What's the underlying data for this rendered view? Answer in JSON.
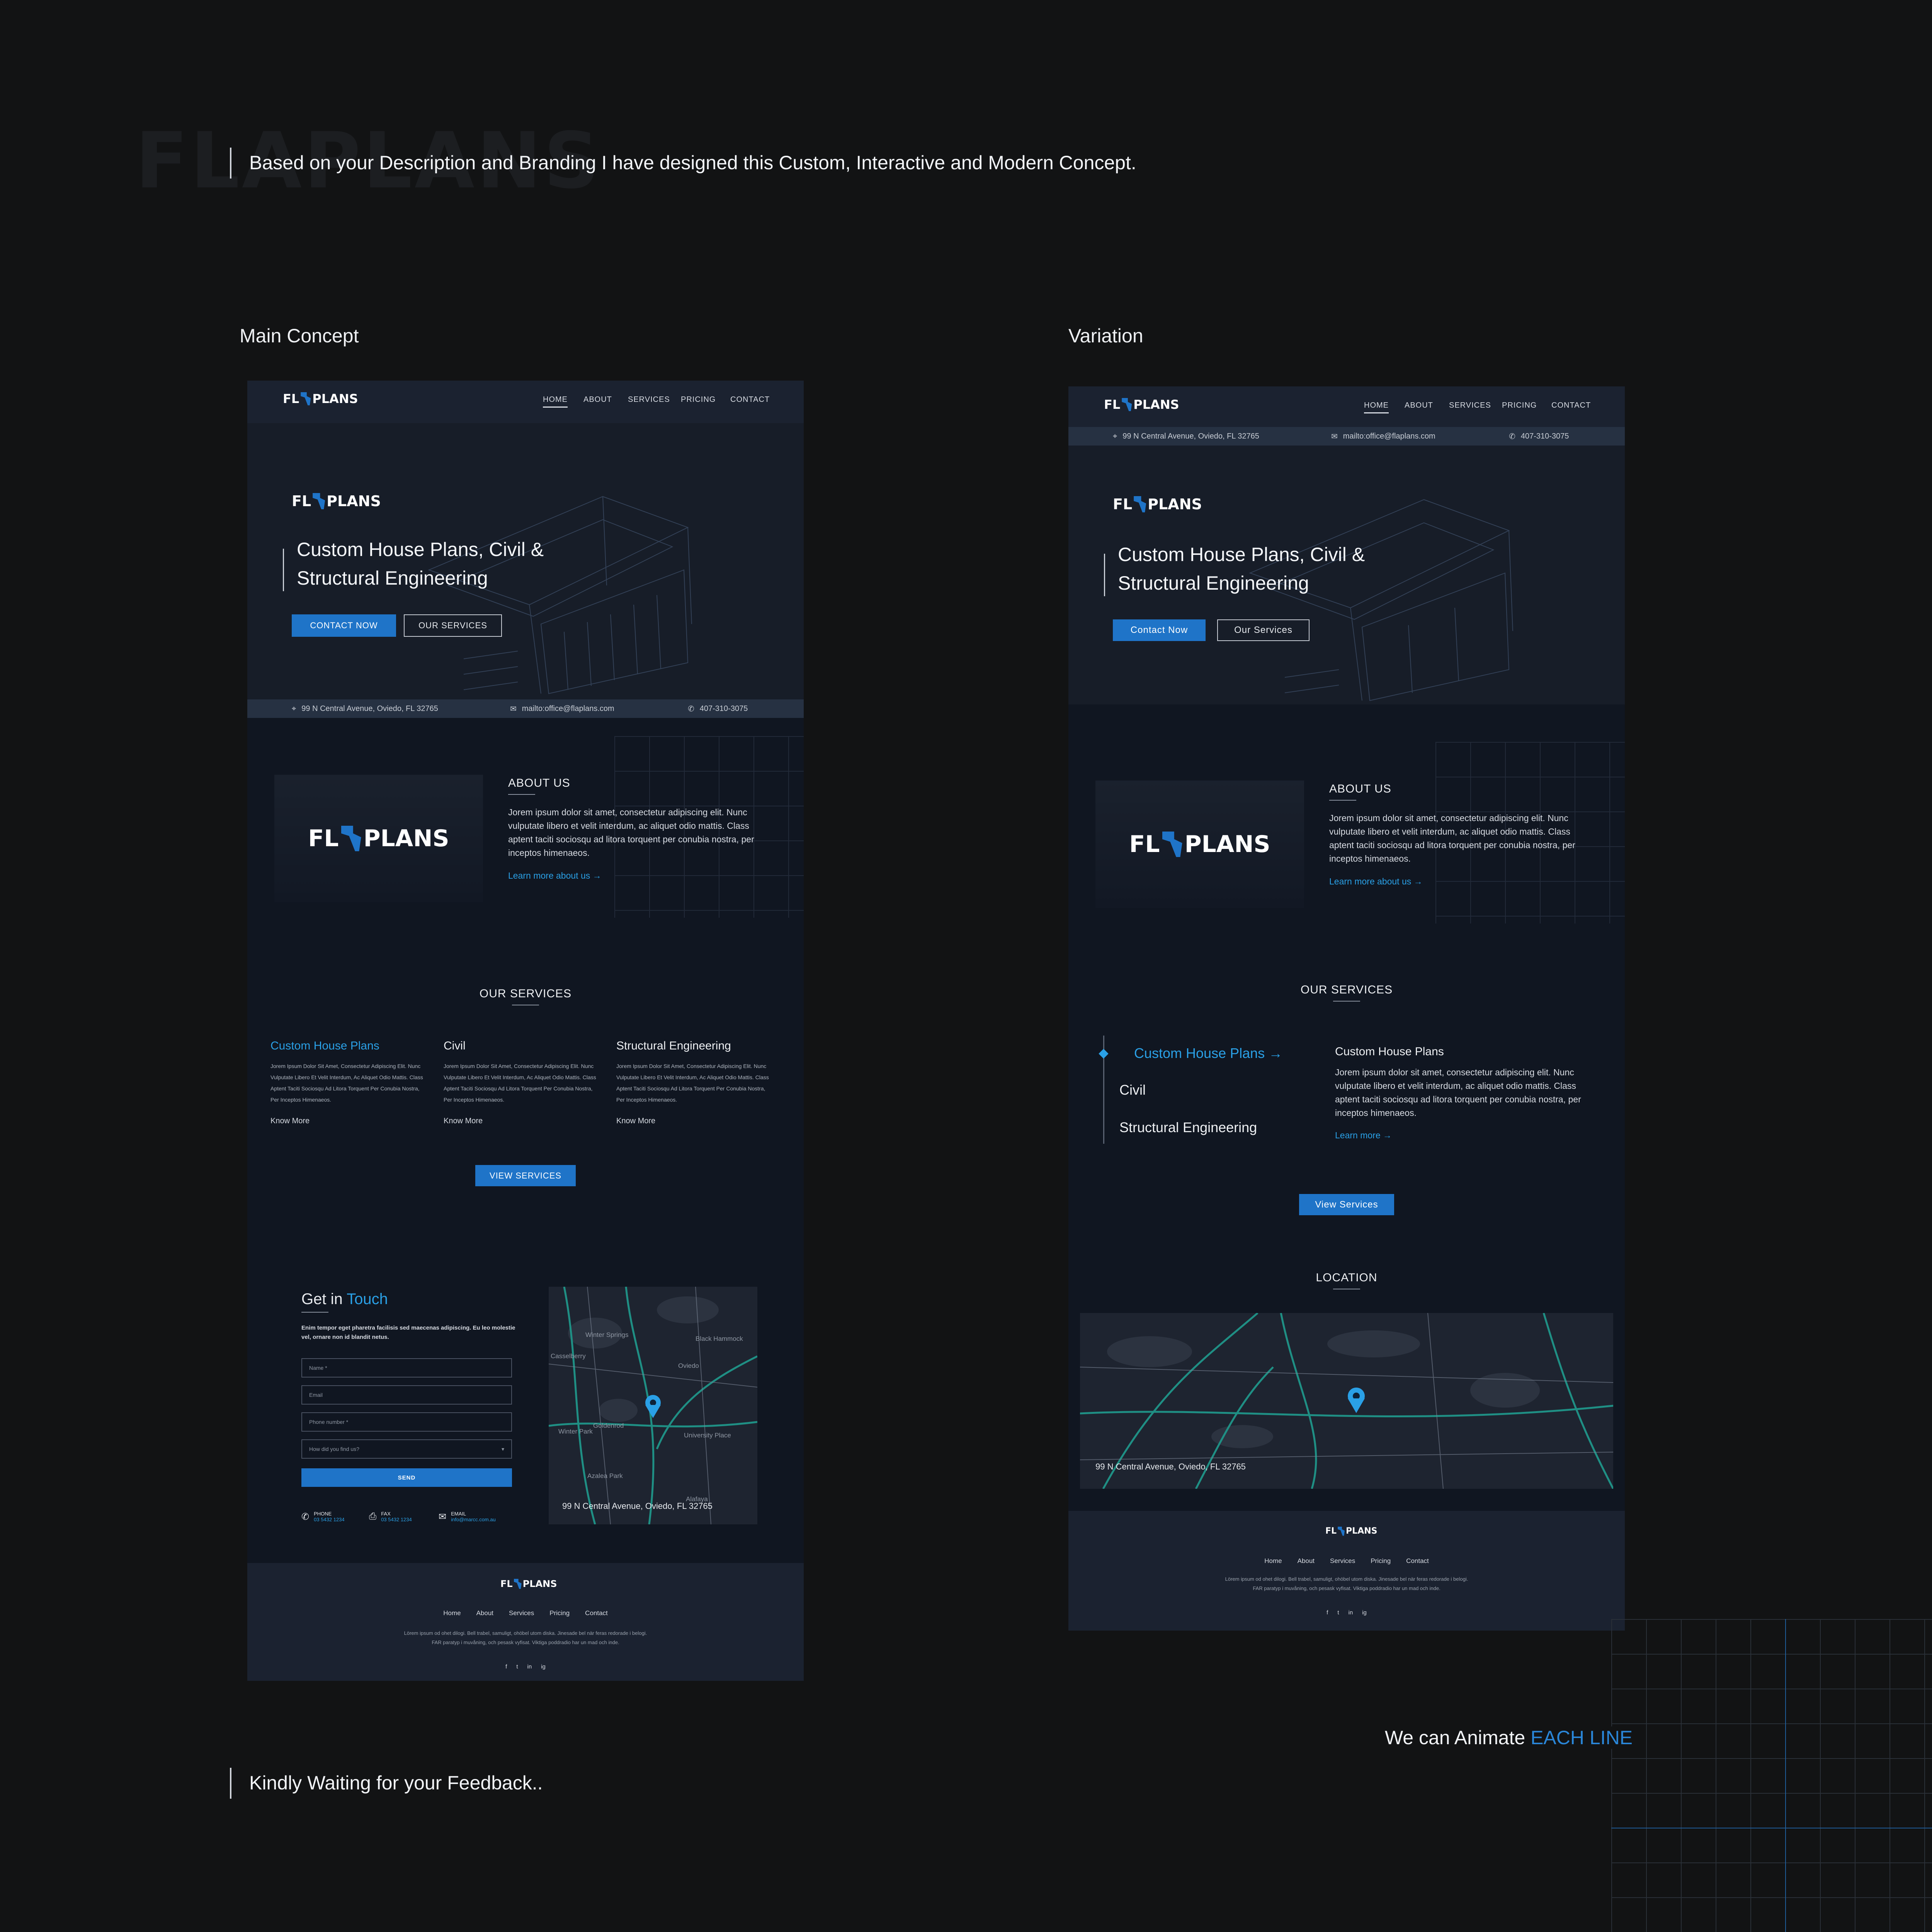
{
  "watermark": {
    "text": "FLAPLANS"
  },
  "intro": "Based on your Description and Branding I have designed this Custom, Interactive and Modern Concept.",
  "labels": {
    "main": "Main Concept",
    "variation": "Variation"
  },
  "brand": {
    "fl": "FL",
    "plans": "PLANS"
  },
  "nav": {
    "home": "HOME",
    "about": "ABOUT",
    "services": "SERVICES",
    "pricing": "PRICING",
    "contact": "CONTACT"
  },
  "hero": {
    "line1": "Custom House Plans, Civil  &",
    "line2": "Structural Engineering",
    "contact_main": "CONTACT NOW",
    "services_main": "OUR SERVICES",
    "contact_var": "Contact Now",
    "services_var": "Our Services"
  },
  "info": {
    "address": "99 N Central Avenue, Oviedo, FL 32765",
    "email": "mailto:office@flaplans.com",
    "phone": "407-310-3075"
  },
  "about": {
    "heading": "ABOUT US",
    "text": "Jorem ipsum dolor sit amet, consectetur adipiscing elit. Nunc vulputate libero et velit interdum, ac aliquet odio mattis. Class aptent taciti sociosqu ad litora torquent per conubia nostra, per inceptos himenaeos.",
    "link": "Learn more about us  →"
  },
  "services": {
    "heading": "OUR SERVICES",
    "items": [
      {
        "title": "Custom House Plans",
        "desc": "Jorem Ipsum Dolor Sit Amet, Consectetur Adipiscing Elit. Nunc Vulputate Libero Et Velit Interdum, Ac Aliquet Odio Mattis. Class Aptent Taciti Sociosqu Ad Litora Torquent Per Conubia Nostra, Per Inceptos Himenaeos.",
        "more": "Know More"
      },
      {
        "title": "Civil",
        "desc": "Jorem Ipsum Dolor Sit Amet, Consectetur Adipiscing Elit. Nunc Vulputate Libero Et Velit Interdum, Ac Aliquet Odio Mattis. Class Aptent Taciti Sociosqu Ad Litora Torquent Per Conubia Nostra, Per Inceptos Himenaeos.",
        "more": "Know More"
      },
      {
        "title": "Structural Engineering",
        "desc": "Jorem Ipsum Dolor Sit Amet, Consectetur Adipiscing Elit. Nunc Vulputate Libero Et Velit Interdum, Ac Aliquet Odio Mattis. Class Aptent Taciti Sociosqu Ad Litora Torquent Per Conubia Nostra, Per Inceptos Himenaeos.",
        "more": "Know More"
      }
    ],
    "view_main": "VIEW SERVICES",
    "view_var": "View Services",
    "var_tab1": "Custom House Plans  →",
    "var_tab2": "Civil",
    "var_tab3": "Structural Engineering",
    "var_detail_title": "Custom House Plans",
    "var_detail_text": "Jorem ipsum dolor sit amet, consectetur adipiscing elit. Nunc vulputate libero et velit interdum, ac aliquet odio mattis. Class aptent taciti sociosqu ad litora torquent per conubia nostra, per inceptos himenaeos.",
    "var_learn": "Learn more  →"
  },
  "contact": {
    "heading_a": "Get in ",
    "heading_b": "Touch",
    "text": "Enim tempor eget pharetra facilisis sed maecenas adipiscing. Eu leo molestie vel, ornare non id blandit netus.",
    "name_ph": "Name *",
    "email_ph": "Email",
    "phone_ph": "Phone number *",
    "select_ph": "How did you find us?",
    "send": "SEND",
    "phone_lbl": "PHONE",
    "phone_val": "03 5432 1234",
    "fax_lbl": "FAX",
    "fax_val": "03 5432 1234",
    "email_lbl": "EMAIL",
    "email_val": "info@marcc.com.au"
  },
  "map_labels": {
    "winter_springs": "Winter Springs",
    "casselberry": "Casselberry",
    "black_hammock": "Black Hammock",
    "oviedo": "Oviedo",
    "goldenrod": "Goldenrod",
    "winter_park": "Winter Park",
    "university_place": "University Place",
    "azalea_park": "Azalea Park",
    "alafaya": "Alafaya"
  },
  "location_heading": "LOCATION",
  "footer": {
    "links": [
      "Home",
      "About",
      "Services",
      "Pricing",
      "Contact"
    ],
    "text1": "Lörem ipsum od ohet dilogi. Bell trabel, samuligt, ohöbel utom diska. Jinesade bel när feras redorade i belogi.",
    "text2": "FAR paratyp i muvåning, och pesask vyfisat. Viktiga poddradio har un mad och inde.",
    "social": [
      "f",
      "t",
      "in",
      "ig"
    ]
  },
  "bottom": {
    "feedback": "Kindly Waiting for your Feedback..",
    "animate_a": "We can Animate ",
    "animate_b": "EACH LINE"
  },
  "colors": {
    "accent": "#1f74c8",
    "link": "#2aa0e6",
    "bg": "#121314"
  }
}
